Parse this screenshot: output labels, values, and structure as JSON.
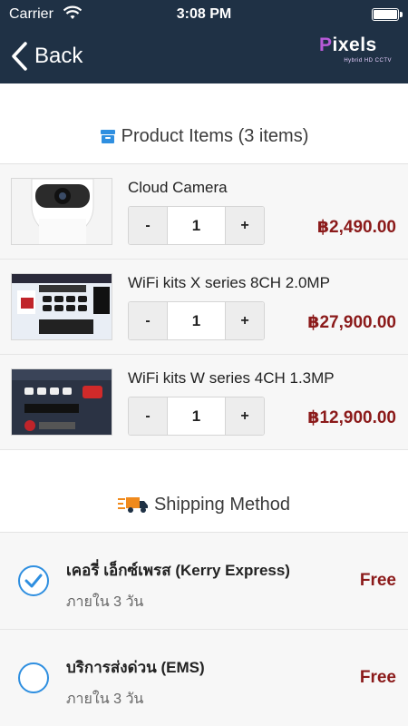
{
  "status_bar": {
    "carrier": "Carrier",
    "time": "3:08 PM"
  },
  "nav": {
    "back_label": "Back",
    "logo": {
      "brand_first": "P",
      "brand_rest": "ixels",
      "tagline": "Hybrid HD CCTV"
    }
  },
  "products_section": {
    "title": "Product Items (3 items)",
    "items": [
      {
        "name": "Cloud Camera",
        "quantity": "1",
        "price": "฿2,490.00",
        "image": "cloud-camera-image"
      },
      {
        "name": "WiFi kits X series 8CH 2.0MP",
        "quantity": "1",
        "price": "฿27,900.00",
        "image": "wifi-kit-x-image"
      },
      {
        "name": "WiFi kits W series 4CH 1.3MP",
        "quantity": "1",
        "price": "฿12,900.00",
        "image": "wifi-kit-w-image"
      }
    ],
    "minus_label": "-",
    "plus_label": "+"
  },
  "shipping_section": {
    "title": "Shipping Method",
    "options": [
      {
        "name": "เคอรี่ เอ็กซ์เพรส (Kerry Express)",
        "eta": "ภายใน 3 วัน",
        "fee": "Free",
        "selected": true
      },
      {
        "name": "บริการส่งด่วน (EMS)",
        "eta": "ภายใน 3 วัน",
        "fee": "Free",
        "selected": false
      }
    ]
  },
  "colors": {
    "nav_bg": "#1f3145",
    "accent": "#2f8fe0",
    "price": "#8b1a1a"
  }
}
